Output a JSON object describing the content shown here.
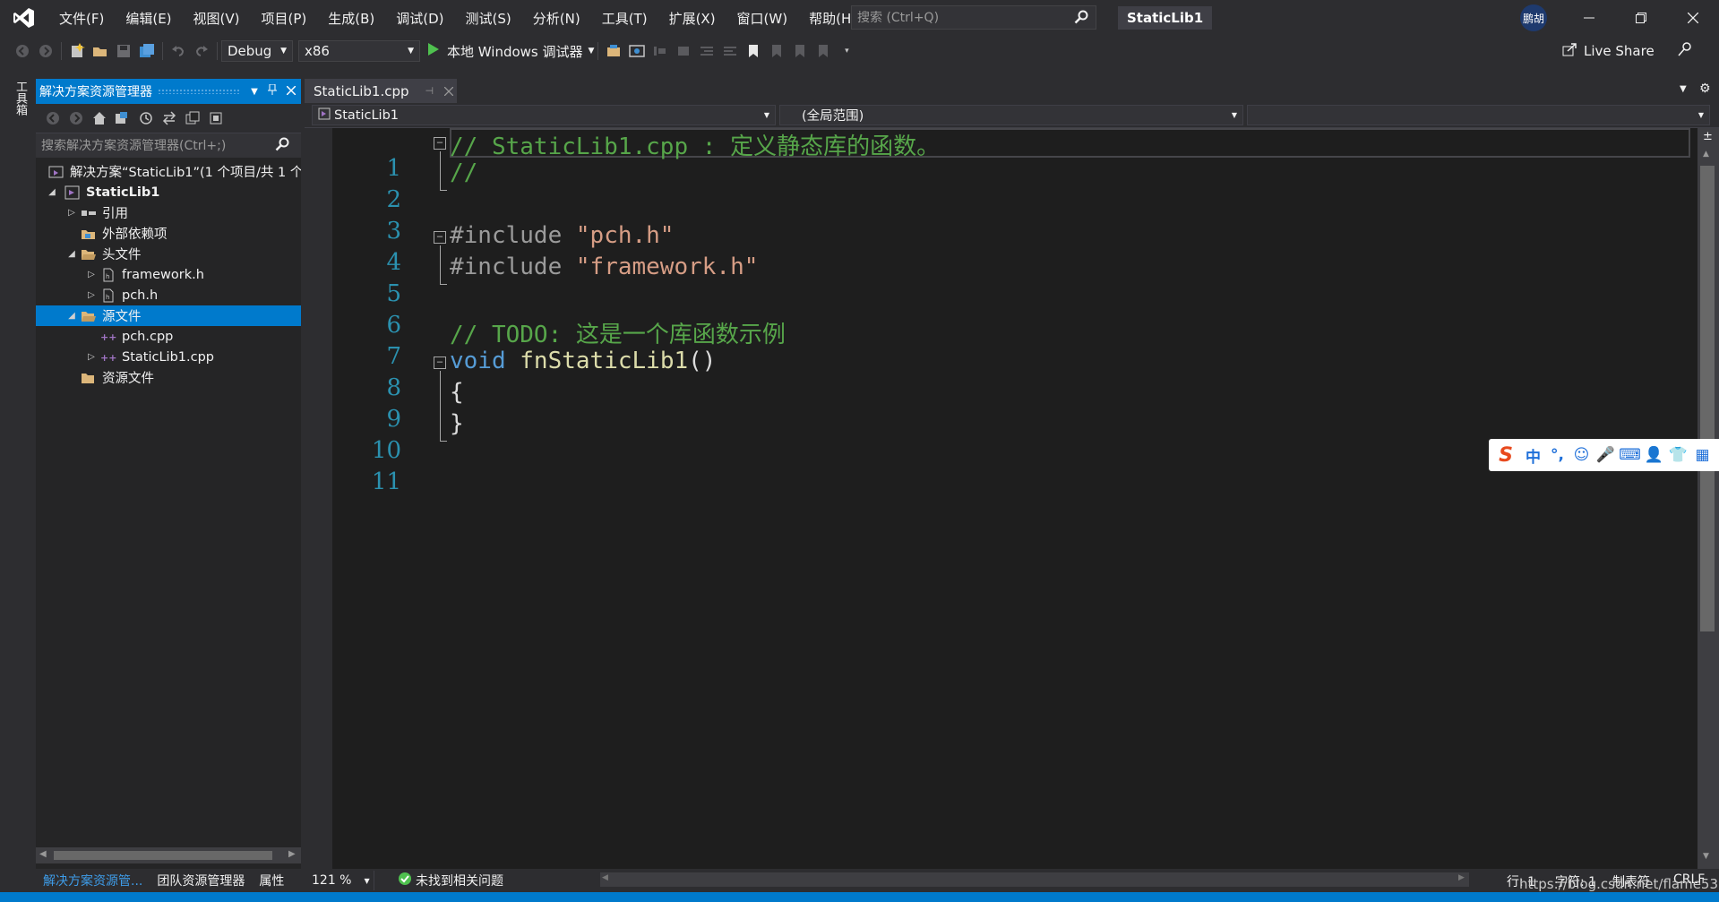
{
  "menubar": {
    "items": [
      "文件(F)",
      "编辑(E)",
      "视图(V)",
      "项目(P)",
      "生成(B)",
      "调试(D)",
      "测试(S)",
      "分析(N)",
      "工具(T)",
      "扩展(X)",
      "窗口(W)",
      "帮助(H)"
    ],
    "search_placeholder": "搜索 (Ctrl+Q)",
    "solution_name": "StaticLib1",
    "user_badge": "鹏胡"
  },
  "toolbar": {
    "config": "Debug",
    "platform": "x86",
    "debugger": "本地 Windows 调试器",
    "live_share": "Live Share"
  },
  "toolbox": {
    "label": "工具箱"
  },
  "solution_explorer": {
    "title": "解决方案资源管理器",
    "search_placeholder": "搜索解决方案资源管理器(Ctrl+;)",
    "tree": [
      {
        "label": "解决方案“StaticLib1”(1 个项目/共 1 个"
      },
      {
        "label": "StaticLib1"
      },
      {
        "label": "引用"
      },
      {
        "label": "外部依赖项"
      },
      {
        "label": "头文件"
      },
      {
        "label": "framework.h"
      },
      {
        "label": "pch.h"
      },
      {
        "label": "源文件"
      },
      {
        "label": "pch.cpp"
      },
      {
        "label": "StaticLib1.cpp"
      },
      {
        "label": "资源文件"
      }
    ],
    "bottom_tabs": [
      "解决方案资源管...",
      "团队资源管理器",
      "属性"
    ]
  },
  "editor": {
    "tab_label": "StaticLib1.cpp",
    "nav_project": "StaticLib1",
    "nav_scope": "(全局范围)",
    "line_numbers": [
      "1",
      "2",
      "3",
      "4",
      "5",
      "6",
      "7",
      "8",
      "9",
      "10",
      "11"
    ],
    "code": {
      "l1": "// StaticLib1.cpp : 定义静态库的函数。",
      "l2": "//",
      "l4_pp": "#include ",
      "l4_str": "\"pch.h\"",
      "l5_pp": "#include ",
      "l5_str": "\"framework.h\"",
      "l7": "// TODO: 这是一个库函数示例",
      "l8_kw": "void ",
      "l8_fn": "fnStaticLib1",
      "l8_paren": "()",
      "l9": "{",
      "l10": "}"
    },
    "zoom": "121 %",
    "issues": "未找到相关问题"
  },
  "statusbar": {
    "row": "行: 1",
    "char": "字符: 1",
    "tab": "制表符",
    "eol": "CRLF",
    "watermark": "https://blog.csdn.net/flame53"
  },
  "ime": {
    "items": [
      "S",
      "中",
      "°,",
      "☺",
      "🎤",
      "⌨",
      "👤",
      "👕",
      "▦"
    ]
  },
  "colors": {
    "accent": "#007acc",
    "comment": "#57a64a",
    "keyword": "#569cd6",
    "string": "#d69d85",
    "function": "#dcdcaa",
    "line_number": "#2b91af"
  }
}
